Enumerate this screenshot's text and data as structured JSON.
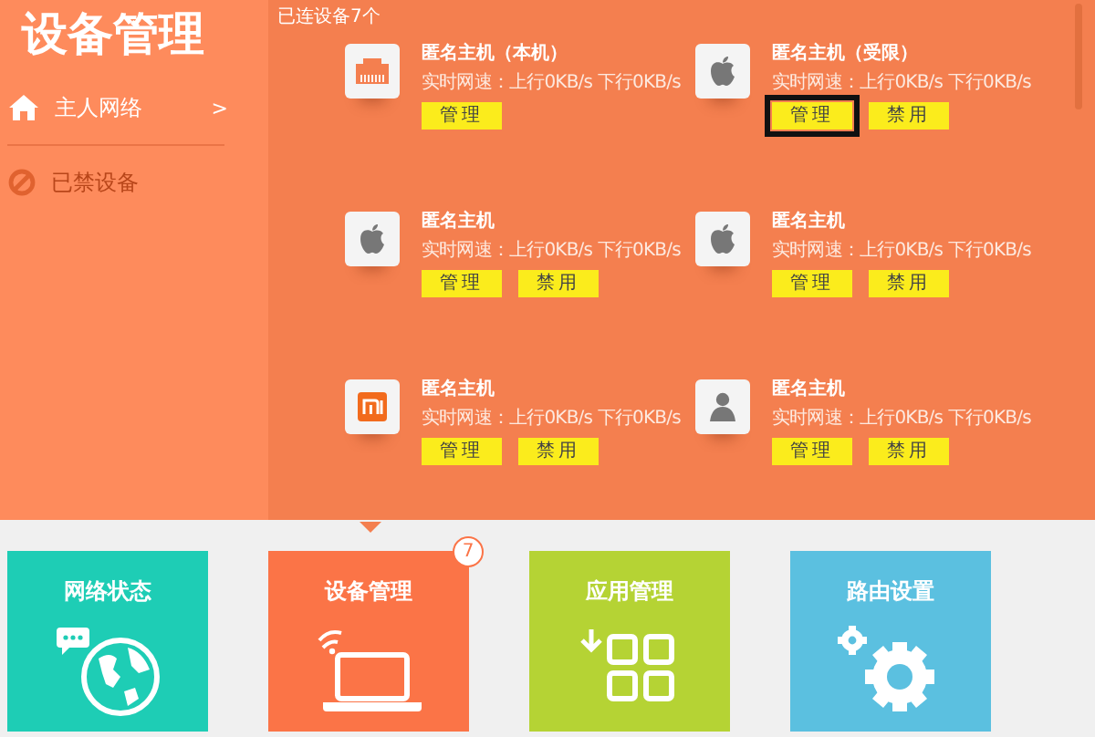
{
  "sidebar": {
    "title": "设备管理",
    "items": [
      {
        "kind": "home",
        "label": "主人网络",
        "chevron": ">",
        "selected": true
      },
      {
        "kind": "ban",
        "label": "已禁设备",
        "selected": false
      }
    ]
  },
  "main": {
    "heading": "已连设备7个",
    "devices": [
      {
        "kind": "ethernet",
        "name": "匿名主机（本机）",
        "speed": "实时网速：上行0KB/s 下行0KB/s",
        "buttons": [
          {
            "label": "管理",
            "highlighted": false
          }
        ]
      },
      {
        "kind": "apple",
        "name": "匿名主机（受限）",
        "speed": "实时网速：上行0KB/s 下行0KB/s",
        "buttons": [
          {
            "label": "管理",
            "highlighted": true
          },
          {
            "label": "禁用",
            "highlighted": false
          }
        ]
      },
      {
        "kind": "apple",
        "name": "匿名主机",
        "speed": "实时网速：上行0KB/s 下行0KB/s",
        "buttons": [
          {
            "label": "管理",
            "highlighted": false
          },
          {
            "label": "禁用",
            "highlighted": false
          }
        ]
      },
      {
        "kind": "apple",
        "name": "匿名主机",
        "speed": "实时网速：上行0KB/s 下行0KB/s",
        "buttons": [
          {
            "label": "管理",
            "highlighted": false
          },
          {
            "label": "禁用",
            "highlighted": false
          }
        ]
      },
      {
        "kind": "mi",
        "name": "匿名主机",
        "speed": "实时网速：上行0KB/s 下行0KB/s",
        "buttons": [
          {
            "label": "管理",
            "highlighted": false
          },
          {
            "label": "禁用",
            "highlighted": false
          }
        ]
      },
      {
        "kind": "person",
        "name": "匿名主机",
        "speed": "实时网速：上行0KB/s 下行0KB/s",
        "buttons": [
          {
            "label": "管理",
            "highlighted": false
          },
          {
            "label": "禁用",
            "highlighted": false
          }
        ]
      }
    ]
  },
  "nav_tiles": [
    {
      "kind": "globe",
      "label": "网络状态",
      "color": "#1ecdb5",
      "selected": false
    },
    {
      "kind": "laptop",
      "label": "设备管理",
      "color": "#fb7447",
      "selected": true,
      "badge": "7"
    },
    {
      "kind": "apps",
      "label": "应用管理",
      "color": "#b5d334",
      "selected": false
    },
    {
      "kind": "gears",
      "label": "路由设置",
      "color": "#5bc0e0",
      "selected": false
    }
  ]
}
